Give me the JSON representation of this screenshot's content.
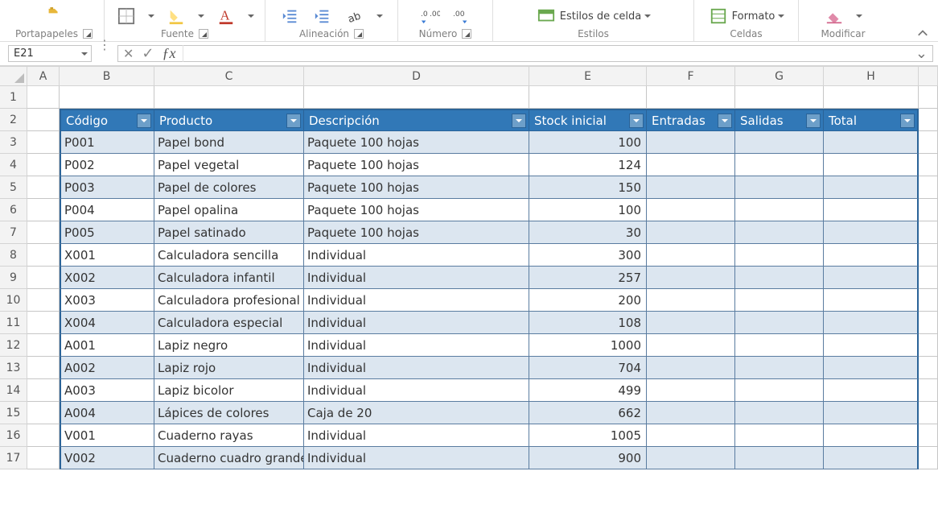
{
  "ribbon": {
    "groups": {
      "portapapeles": "Portapapeles",
      "fuente": "Fuente",
      "alineacion": "Alineación",
      "numero": "Número",
      "estilos": "Estilos",
      "celdas": "Celdas",
      "modificar": "Modificar"
    },
    "buttons": {
      "estilos_celda": "Estilos de celda",
      "formato": "Formato"
    }
  },
  "name_box": "E21",
  "formula_value": "",
  "columns": [
    "A",
    "B",
    "C",
    "D",
    "E",
    "F",
    "G",
    "H"
  ],
  "table": {
    "headers": [
      "Código",
      "Producto",
      "Descripción",
      "Stock inicial",
      "Entradas",
      "Salidas",
      "Total"
    ],
    "rows": [
      {
        "codigo": "P001",
        "producto": "Papel bond",
        "descripcion": "Paquete 100 hojas",
        "stock": "100",
        "entradas": "",
        "salidas": "",
        "total": ""
      },
      {
        "codigo": "P002",
        "producto": "Papel vegetal",
        "descripcion": "Paquete 100 hojas",
        "stock": "124",
        "entradas": "",
        "salidas": "",
        "total": ""
      },
      {
        "codigo": "P003",
        "producto": "Papel de colores",
        "descripcion": "Paquete 100 hojas",
        "stock": "150",
        "entradas": "",
        "salidas": "",
        "total": ""
      },
      {
        "codigo": "P004",
        "producto": "Papel opalina",
        "descripcion": "Paquete 100 hojas",
        "stock": "100",
        "entradas": "",
        "salidas": "",
        "total": ""
      },
      {
        "codigo": "P005",
        "producto": "Papel satinado",
        "descripcion": "Paquete 100 hojas",
        "stock": "30",
        "entradas": "",
        "salidas": "",
        "total": ""
      },
      {
        "codigo": "X001",
        "producto": "Calculadora sencilla",
        "descripcion": "Individual",
        "stock": "300",
        "entradas": "",
        "salidas": "",
        "total": ""
      },
      {
        "codigo": "X002",
        "producto": "Calculadora infantil",
        "descripcion": "Individual",
        "stock": "257",
        "entradas": "",
        "salidas": "",
        "total": ""
      },
      {
        "codigo": "X003",
        "producto": "Calculadora profesional",
        "descripcion": "Individual",
        "stock": "200",
        "entradas": "",
        "salidas": "",
        "total": ""
      },
      {
        "codigo": "X004",
        "producto": "Calculadora especial",
        "descripcion": "Individual",
        "stock": "108",
        "entradas": "",
        "salidas": "",
        "total": ""
      },
      {
        "codigo": "A001",
        "producto": "Lapiz negro",
        "descripcion": "Individual",
        "stock": "1000",
        "entradas": "",
        "salidas": "",
        "total": ""
      },
      {
        "codigo": "A002",
        "producto": "Lapiz rojo",
        "descripcion": "Individual",
        "stock": "704",
        "entradas": "",
        "salidas": "",
        "total": ""
      },
      {
        "codigo": "A003",
        "producto": "Lapiz bicolor",
        "descripcion": "Individual",
        "stock": "499",
        "entradas": "",
        "salidas": "",
        "total": ""
      },
      {
        "codigo": "A004",
        "producto": "Lápices de colores",
        "descripcion": "Caja de 20",
        "stock": "662",
        "entradas": "",
        "salidas": "",
        "total": ""
      },
      {
        "codigo": "V001",
        "producto": "Cuaderno rayas",
        "descripcion": "Individual",
        "stock": "1005",
        "entradas": "",
        "salidas": "",
        "total": ""
      },
      {
        "codigo": "V002",
        "producto": "Cuaderno cuadro grande",
        "descripcion": "Individual",
        "stock": "900",
        "entradas": "",
        "salidas": "",
        "total": ""
      }
    ]
  }
}
